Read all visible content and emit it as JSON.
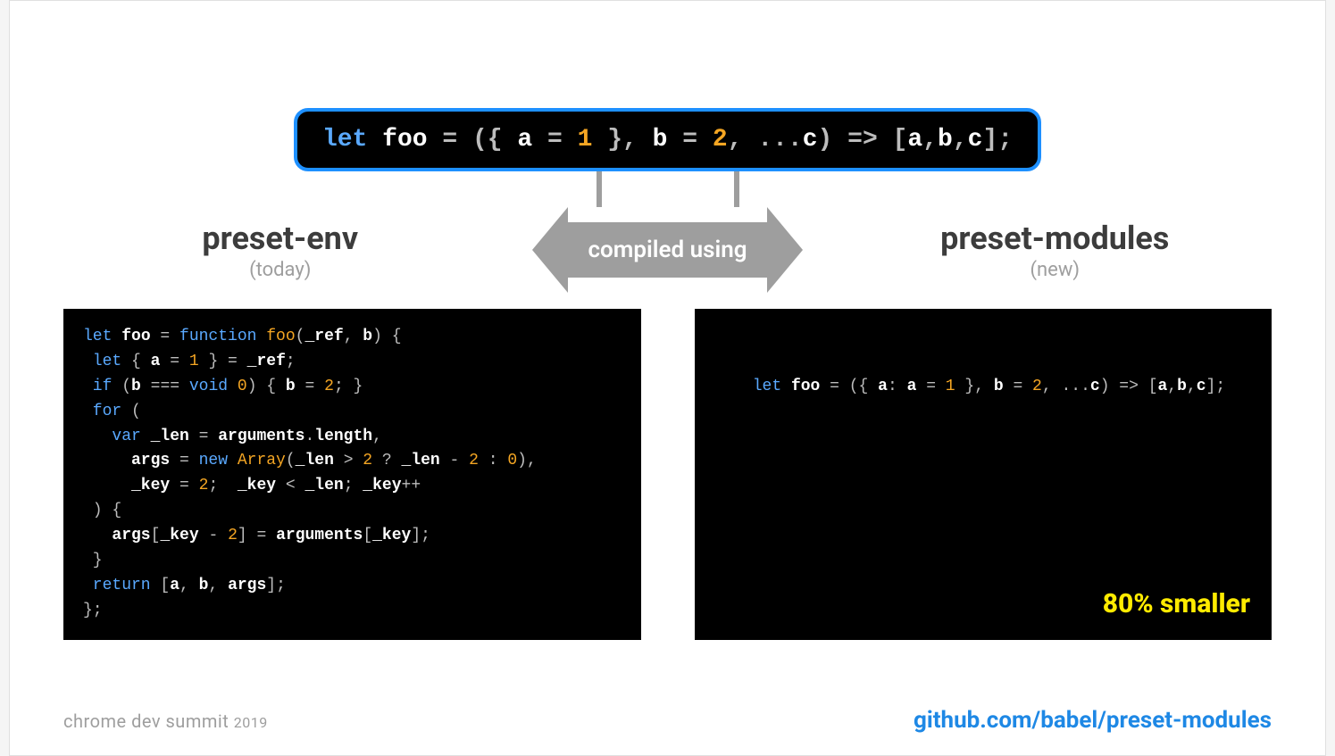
{
  "top_code": {
    "tokens": [
      {
        "t": "let ",
        "c": "k"
      },
      {
        "t": "foo",
        "c": "id"
      },
      {
        "t": " = ({ ",
        "c": "p"
      },
      {
        "t": "a",
        "c": "id"
      },
      {
        "t": " = ",
        "c": "p"
      },
      {
        "t": "1",
        "c": "num"
      },
      {
        "t": " }, ",
        "c": "p"
      },
      {
        "t": "b",
        "c": "id"
      },
      {
        "t": " = ",
        "c": "p"
      },
      {
        "t": "2",
        "c": "num"
      },
      {
        "t": ", ...",
        "c": "p"
      },
      {
        "t": "c",
        "c": "id"
      },
      {
        "t": ") => [",
        "c": "p"
      },
      {
        "t": "a",
        "c": "id"
      },
      {
        "t": ",",
        "c": "p"
      },
      {
        "t": "b",
        "c": "id"
      },
      {
        "t": ",",
        "c": "p"
      },
      {
        "t": "c",
        "c": "id"
      },
      {
        "t": "];",
        "c": "p"
      }
    ]
  },
  "arrow_label": "compiled using",
  "left": {
    "title": "preset-env",
    "sub": "(today)",
    "code_tokens": [
      {
        "t": "let ",
        "c": "k"
      },
      {
        "t": "foo",
        "c": "id"
      },
      {
        "t": " = ",
        "c": "p"
      },
      {
        "t": "function ",
        "c": "k"
      },
      {
        "t": "foo",
        "c": "fn"
      },
      {
        "t": "(",
        "c": "p"
      },
      {
        "t": "_ref",
        "c": "id"
      },
      {
        "t": ", ",
        "c": "p"
      },
      {
        "t": "b",
        "c": "id"
      },
      {
        "t": ") {\n",
        "c": "p"
      },
      {
        "t": " let ",
        "c": "k"
      },
      {
        "t": "{ ",
        "c": "p"
      },
      {
        "t": "a",
        "c": "id"
      },
      {
        "t": " = ",
        "c": "p"
      },
      {
        "t": "1",
        "c": "num"
      },
      {
        "t": " } = ",
        "c": "p"
      },
      {
        "t": "_ref",
        "c": "id"
      },
      {
        "t": ";\n",
        "c": "p"
      },
      {
        "t": " if ",
        "c": "k"
      },
      {
        "t": "(",
        "c": "p"
      },
      {
        "t": "b",
        "c": "id"
      },
      {
        "t": " === ",
        "c": "p"
      },
      {
        "t": "void ",
        "c": "k"
      },
      {
        "t": "0",
        "c": "num"
      },
      {
        "t": ") { ",
        "c": "p"
      },
      {
        "t": "b",
        "c": "id"
      },
      {
        "t": " = ",
        "c": "p"
      },
      {
        "t": "2",
        "c": "num"
      },
      {
        "t": "; }\n",
        "c": "p"
      },
      {
        "t": " for ",
        "c": "k"
      },
      {
        "t": "(\n",
        "c": "p"
      },
      {
        "t": "   var ",
        "c": "k"
      },
      {
        "t": "_len",
        "c": "id"
      },
      {
        "t": " = ",
        "c": "p"
      },
      {
        "t": "arguments",
        "c": "id"
      },
      {
        "t": ".",
        "c": "p"
      },
      {
        "t": "length",
        "c": "id"
      },
      {
        "t": ",\n",
        "c": "p"
      },
      {
        "t": "     args",
        "c": "id"
      },
      {
        "t": " = ",
        "c": "p"
      },
      {
        "t": "new ",
        "c": "k"
      },
      {
        "t": "Array",
        "c": "fn"
      },
      {
        "t": "(",
        "c": "p"
      },
      {
        "t": "_len",
        "c": "id"
      },
      {
        "t": " > ",
        "c": "p"
      },
      {
        "t": "2",
        "c": "num"
      },
      {
        "t": " ? ",
        "c": "p"
      },
      {
        "t": "_len",
        "c": "id"
      },
      {
        "t": " - ",
        "c": "p"
      },
      {
        "t": "2",
        "c": "num"
      },
      {
        "t": " : ",
        "c": "p"
      },
      {
        "t": "0",
        "c": "num"
      },
      {
        "t": "),\n",
        "c": "p"
      },
      {
        "t": "     _key",
        "c": "id"
      },
      {
        "t": " = ",
        "c": "p"
      },
      {
        "t": "2",
        "c": "num"
      },
      {
        "t": ";  ",
        "c": "p"
      },
      {
        "t": "_key",
        "c": "id"
      },
      {
        "t": " < ",
        "c": "p"
      },
      {
        "t": "_len",
        "c": "id"
      },
      {
        "t": "; ",
        "c": "p"
      },
      {
        "t": "_key",
        "c": "id"
      },
      {
        "t": "++\n",
        "c": "p"
      },
      {
        "t": " ) {\n",
        "c": "p"
      },
      {
        "t": "   args",
        "c": "id"
      },
      {
        "t": "[",
        "c": "p"
      },
      {
        "t": "_key",
        "c": "id"
      },
      {
        "t": " - ",
        "c": "p"
      },
      {
        "t": "2",
        "c": "num"
      },
      {
        "t": "] = ",
        "c": "p"
      },
      {
        "t": "arguments",
        "c": "id"
      },
      {
        "t": "[",
        "c": "p"
      },
      {
        "t": "_key",
        "c": "id"
      },
      {
        "t": "];\n",
        "c": "p"
      },
      {
        "t": " }\n",
        "c": "p"
      },
      {
        "t": " return ",
        "c": "k"
      },
      {
        "t": "[",
        "c": "p"
      },
      {
        "t": "a",
        "c": "id"
      },
      {
        "t": ", ",
        "c": "p"
      },
      {
        "t": "b",
        "c": "id"
      },
      {
        "t": ", ",
        "c": "p"
      },
      {
        "t": "args",
        "c": "id"
      },
      {
        "t": "];\n",
        "c": "p"
      },
      {
        "t": "};",
        "c": "p"
      }
    ]
  },
  "right": {
    "title": "preset-modules",
    "sub": "(new)",
    "code_tokens": [
      {
        "t": "let ",
        "c": "k"
      },
      {
        "t": "foo",
        "c": "id"
      },
      {
        "t": " = ({ ",
        "c": "p"
      },
      {
        "t": "a",
        "c": "id"
      },
      {
        "t": ": ",
        "c": "p"
      },
      {
        "t": "a",
        "c": "id"
      },
      {
        "t": " = ",
        "c": "p"
      },
      {
        "t": "1",
        "c": "num"
      },
      {
        "t": " }, ",
        "c": "p"
      },
      {
        "t": "b",
        "c": "id"
      },
      {
        "t": " = ",
        "c": "p"
      },
      {
        "t": "2",
        "c": "num"
      },
      {
        "t": ", ...",
        "c": "p"
      },
      {
        "t": "c",
        "c": "id"
      },
      {
        "t": ") => [",
        "c": "p"
      },
      {
        "t": "a",
        "c": "id"
      },
      {
        "t": ",",
        "c": "p"
      },
      {
        "t": "b",
        "c": "id"
      },
      {
        "t": ",",
        "c": "p"
      },
      {
        "t": "c",
        "c": "id"
      },
      {
        "t": "];",
        "c": "p"
      }
    ],
    "badge": "80% smaller"
  },
  "footer": {
    "event": "chrome dev summit",
    "year": "2019",
    "link": "github.com/babel/preset-modules"
  }
}
